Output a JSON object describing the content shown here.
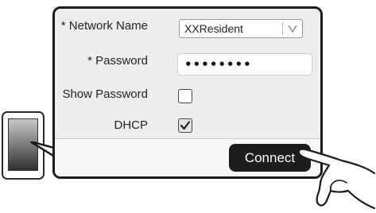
{
  "form": {
    "network_name_label": "* Network Name",
    "network_name_value": "XXResident",
    "password_label": "* Password",
    "password_value": "••••••••",
    "show_password_label": "Show Password",
    "show_password_checked": false,
    "dhcp_label": "DHCP",
    "dhcp_checked": true
  },
  "actions": {
    "connect_label": "Connect"
  },
  "icons": {
    "dropdown": "chevron-down-icon",
    "check": "checkmark-icon",
    "device": "smartphone-icon",
    "pointer": "hand-pointer-icon"
  }
}
